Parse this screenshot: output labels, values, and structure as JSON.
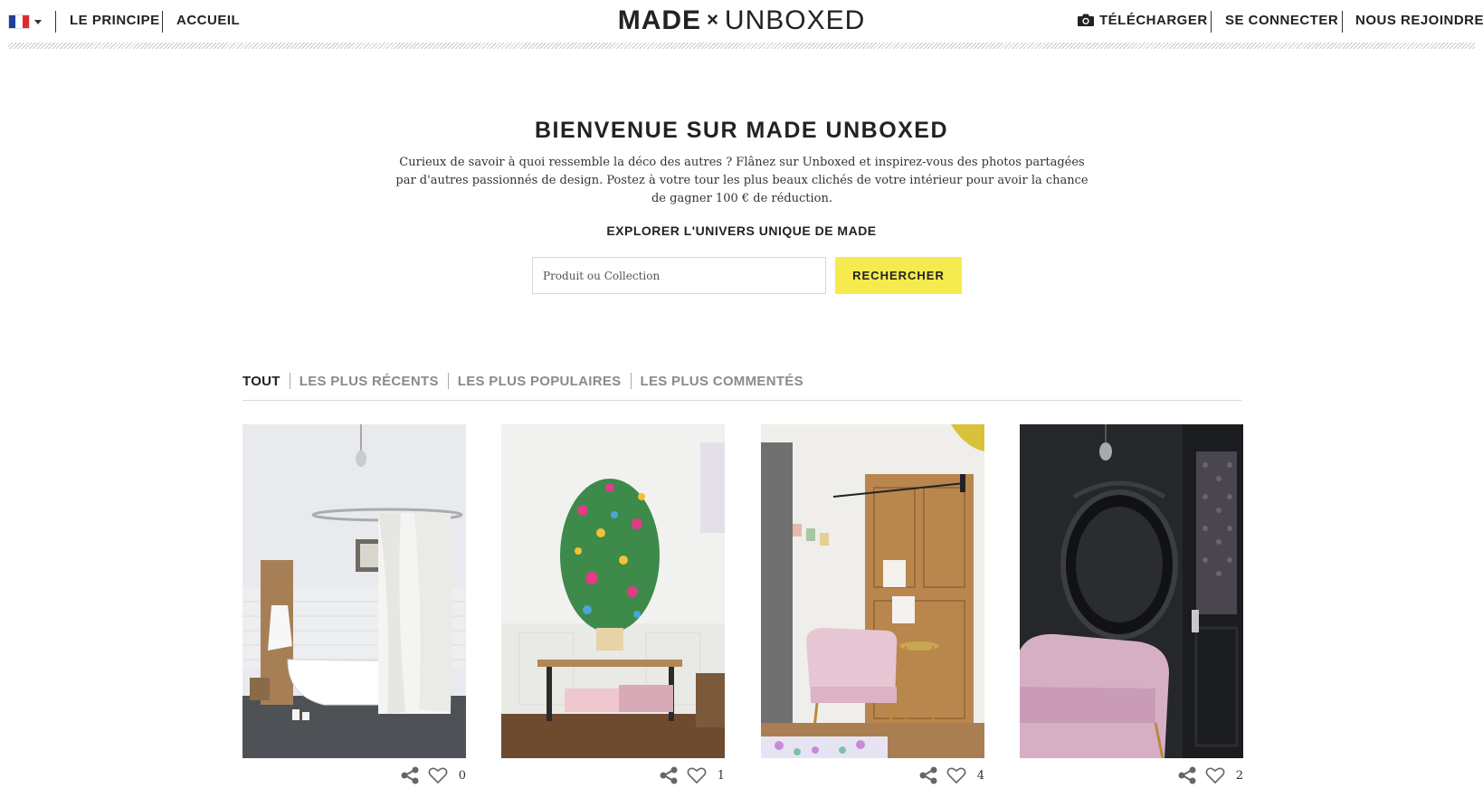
{
  "header": {
    "language": {
      "code": "FR",
      "flag_colors": [
        "#1f3f99",
        "#ffffff",
        "#e0282e"
      ],
      "icon": "chevron-down-icon"
    },
    "nav_left": [
      {
        "label": "LE PRINCIPE"
      },
      {
        "label": "ACCUEIL"
      }
    ],
    "logo": {
      "brand": "MADE",
      "cross": "×",
      "product": "UNBOXED"
    },
    "nav_right": [
      {
        "label": "TÉLÉCHARGER",
        "icon": "camera-icon"
      },
      {
        "label": "SE CONNECTER"
      },
      {
        "label": "NOUS REJOINDRE"
      }
    ]
  },
  "hero": {
    "title": "BIENVENUE SUR MADE UNBOXED",
    "description": "Curieux de savoir à quoi ressemble la déco des autres ? Flânez sur Unboxed et inspirez-vous des photos partagées par d'autres passionnés de design. Postez à votre tour les plus beaux clichés de votre intérieur pour avoir la chance de gagner 100 € de réduction.",
    "explore_label": "EXPLORER L'UNIVERS UNIQUE DE MADE",
    "search": {
      "placeholder": "Produit ou Collection",
      "value": "",
      "button_label": "RECHERCHER",
      "button_color": "#f6eb4e"
    }
  },
  "filters": {
    "tabs": [
      {
        "label": "TOUT",
        "active": true
      },
      {
        "label": "LES PLUS RÉCENTS",
        "active": false
      },
      {
        "label": "LES PLUS POPULAIRES",
        "active": false
      },
      {
        "label": "LES PLUS COMMENTÉS",
        "active": false
      }
    ]
  },
  "gallery": {
    "cards": [
      {
        "photo": "bathroom-clawfoot-tub",
        "likes": "0"
      },
      {
        "photo": "floral-tree-of-life-sculpture",
        "likes": "1"
      },
      {
        "photo": "pink-armchair-wooden-door",
        "likes": "4"
      },
      {
        "photo": "pink-armchair-black-mirror",
        "likes": "2"
      }
    ]
  }
}
